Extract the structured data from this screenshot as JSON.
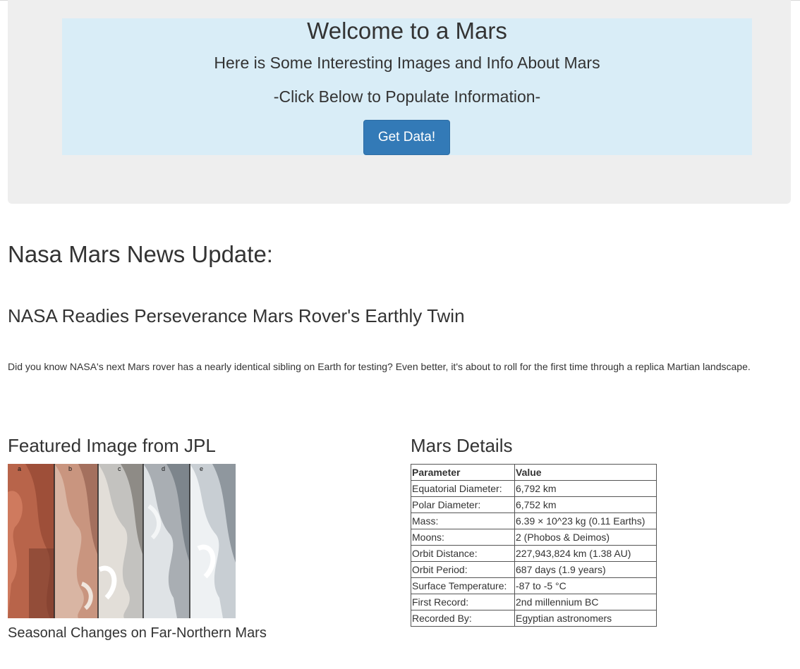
{
  "hero": {
    "title": "Welcome to a Mars",
    "subtitle": "Here is Some Interesting Images and Info About Mars",
    "cta_text": "-Click Below to Populate Information-",
    "button_label": "Get Data!"
  },
  "news": {
    "heading": "Nasa Mars News Update:",
    "title": "NASA Readies Perseverance Mars Rover's Earthly Twin",
    "paragraph": "Did you know NASA's next Mars rover has a nearly identical sibling on Earth for testing? Even better, it's about to roll for the first time through a replica Martian landscape."
  },
  "featured": {
    "heading": "Featured Image from JPL",
    "caption": "Seasonal Changes on Far-Northern Mars",
    "panel_labels": [
      "a",
      "b",
      "c",
      "d",
      "e"
    ]
  },
  "details": {
    "heading": "Mars Details",
    "columns": [
      "Parameter",
      "Value"
    ],
    "rows": [
      [
        "Equatorial Diameter:",
        "6,792 km"
      ],
      [
        "Polar Diameter:",
        "6,752 km"
      ],
      [
        "Mass:",
        "6.39 × 10^23 kg (0.11 Earths)"
      ],
      [
        "Moons:",
        "2 (Phobos & Deimos)"
      ],
      [
        "Orbit Distance:",
        "227,943,824 km (1.38 AU)"
      ],
      [
        "Orbit Period:",
        "687 days (1.9 years)"
      ],
      [
        "Surface Temperature:",
        "-87 to -5 °C"
      ],
      [
        "First Record:",
        "2nd millennium BC"
      ],
      [
        "Recorded By:",
        "Egyptian astronomers"
      ]
    ]
  },
  "colors": {
    "jumbotron_bg": "#eeeeee",
    "hero_bg": "#d9edf7",
    "button_bg": "#337ab7"
  }
}
